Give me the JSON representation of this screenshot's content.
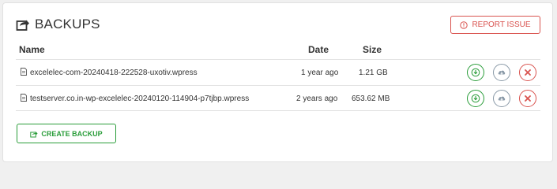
{
  "panel": {
    "title": "BACKUPS",
    "title_icon": "share-export-icon",
    "report_issue_label": "REPORT ISSUE",
    "report_issue_icon": "warning-circle-icon",
    "create_backup_label": "CREATE BACKUP",
    "create_backup_icon": "share-export-icon"
  },
  "table": {
    "columns": [
      "Name",
      "Date",
      "Size"
    ],
    "rows": [
      {
        "name": "excelelec-com-20240418-222528-uxotiv.wpress",
        "date": "1 year ago",
        "size": "1.21 GB"
      },
      {
        "name": "testserver.co.in-wp-excelelec-20240120-114904-p7tjbp.wpress",
        "date": "2 years ago",
        "size": "653.62 MB"
      }
    ],
    "actions": [
      "download-icon",
      "restore-cloud-icon",
      "delete-icon"
    ]
  },
  "colors": {
    "danger": "#d9534f",
    "success": "#2a9d3a",
    "neutral": "#8a9aa8",
    "border": "#e2e2e2"
  }
}
